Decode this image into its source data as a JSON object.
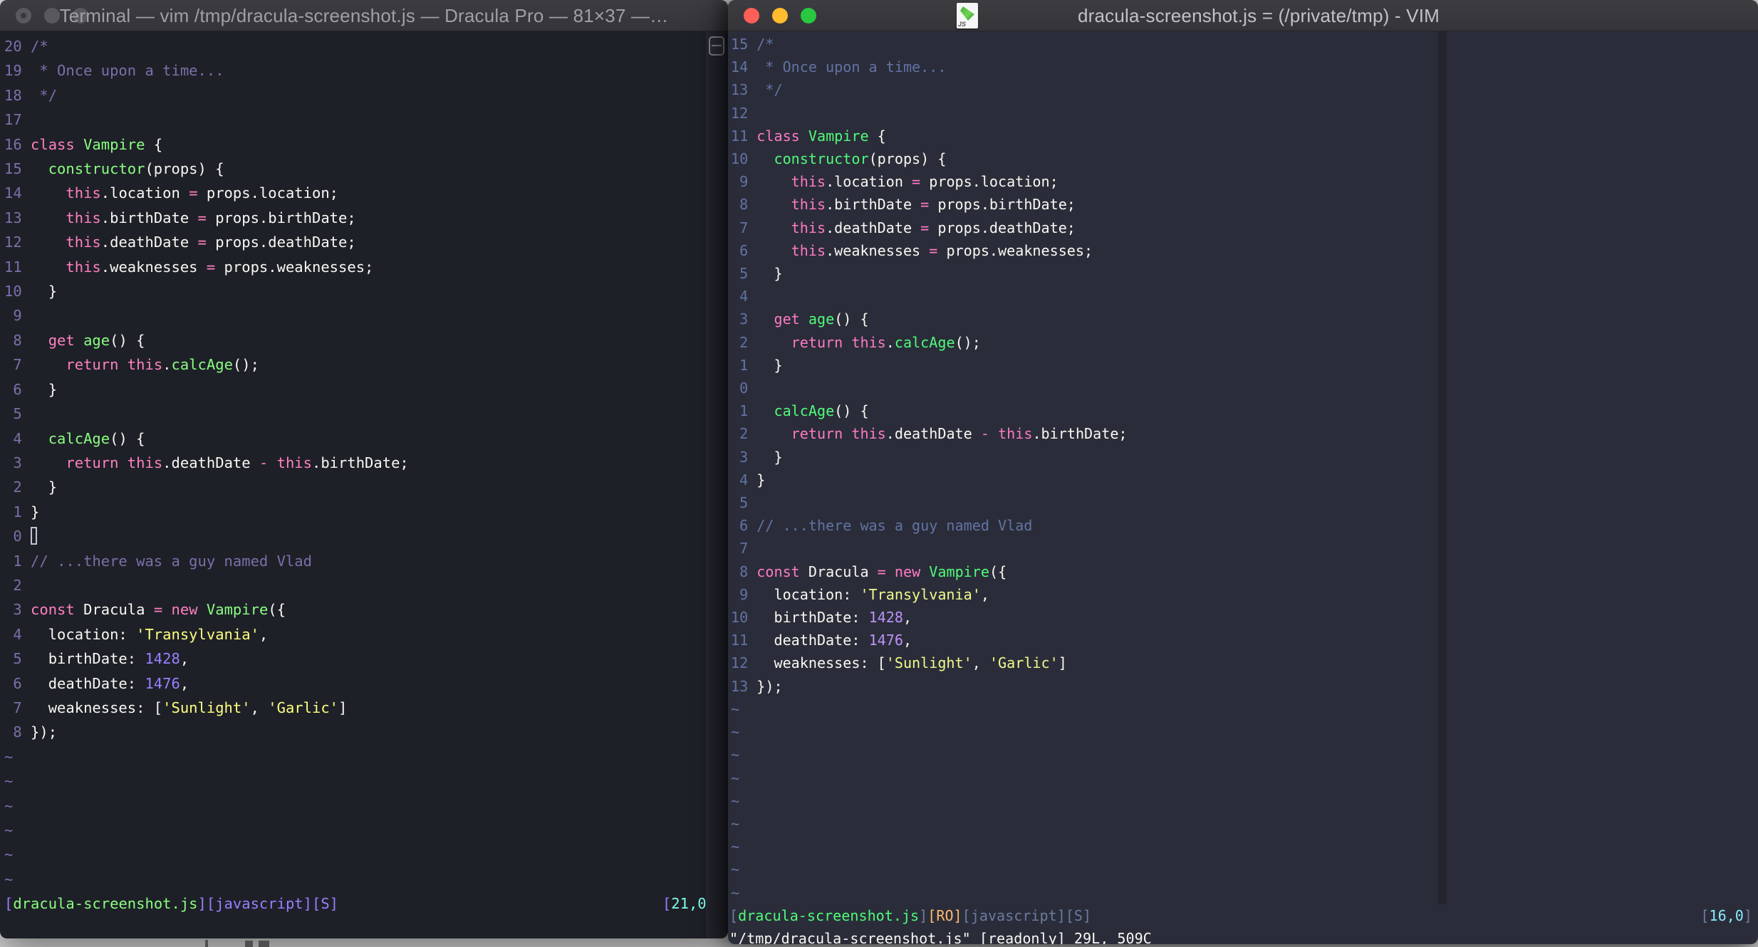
{
  "palette": {
    "desktop_bg": "#d8d8d8",
    "left_theme": {
      "name": "Dracula Pro (Terminal)",
      "background": "#1e2028",
      "foreground": "#f8f8f2",
      "comment": "#7970a9",
      "pink": "#ff80bf",
      "green": "#8aff80",
      "yellow": "#ffff80",
      "purple": "#9580ff",
      "cyan": "#80ffea",
      "line_number": "#7970a9"
    },
    "right_theme": {
      "name": "Dracula (MacVim)",
      "background": "#2a2d39",
      "foreground": "#f8f8f2",
      "comment": "#6272a4",
      "pink": "#ff79c6",
      "green": "#50fa7b",
      "yellow": "#f1fa8c",
      "purple": "#bd93f9",
      "cyan": "#8be9fd",
      "orange": "#ffb86c",
      "line_number": "#6272a4",
      "colorcolumn": "#23242e"
    },
    "traffic_lights_active": {
      "red": "#ff5f57",
      "yellow": "#febc2e",
      "green": "#28c840"
    },
    "traffic_lights_inactive": "#59585e"
  },
  "code_lines": [
    [
      [
        "c",
        "/*"
      ]
    ],
    [
      [
        "c",
        " * Once upon a time..."
      ]
    ],
    [
      [
        "c",
        " */"
      ]
    ],
    [],
    [
      [
        "k",
        "class"
      ],
      [
        "w",
        " "
      ],
      [
        "f",
        "Vampire"
      ],
      [
        "w",
        " {"
      ]
    ],
    [
      [
        "w",
        "  "
      ],
      [
        "f",
        "constructor"
      ],
      [
        "w",
        "(props) {"
      ]
    ],
    [
      [
        "w",
        "    "
      ],
      [
        "k",
        "this"
      ],
      [
        "w",
        ".location "
      ],
      [
        "k",
        "="
      ],
      [
        "w",
        " props.location;"
      ]
    ],
    [
      [
        "w",
        "    "
      ],
      [
        "k",
        "this"
      ],
      [
        "w",
        ".birthDate "
      ],
      [
        "k",
        "="
      ],
      [
        "w",
        " props.birthDate;"
      ]
    ],
    [
      [
        "w",
        "    "
      ],
      [
        "k",
        "this"
      ],
      [
        "w",
        ".deathDate "
      ],
      [
        "k",
        "="
      ],
      [
        "w",
        " props.deathDate;"
      ]
    ],
    [
      [
        "w",
        "    "
      ],
      [
        "k",
        "this"
      ],
      [
        "w",
        ".weaknesses "
      ],
      [
        "k",
        "="
      ],
      [
        "w",
        " props.weaknesses;"
      ]
    ],
    [
      [
        "w",
        "  }"
      ]
    ],
    [],
    [
      [
        "w",
        "  "
      ],
      [
        "k",
        "get"
      ],
      [
        "w",
        " "
      ],
      [
        "f",
        "age"
      ],
      [
        "w",
        "() {"
      ]
    ],
    [
      [
        "w",
        "    "
      ],
      [
        "k",
        "return"
      ],
      [
        "w",
        " "
      ],
      [
        "k",
        "this"
      ],
      [
        "w",
        "."
      ],
      [
        "f",
        "calcAge"
      ],
      [
        "w",
        "();"
      ]
    ],
    [
      [
        "w",
        "  }"
      ]
    ],
    [],
    [
      [
        "w",
        "  "
      ],
      [
        "f",
        "calcAge"
      ],
      [
        "w",
        "() {"
      ]
    ],
    [
      [
        "w",
        "    "
      ],
      [
        "k",
        "return"
      ],
      [
        "w",
        " "
      ],
      [
        "k",
        "this"
      ],
      [
        "w",
        ".deathDate "
      ],
      [
        "k",
        "-"
      ],
      [
        "w",
        " "
      ],
      [
        "k",
        "this"
      ],
      [
        "w",
        ".birthDate;"
      ]
    ],
    [
      [
        "w",
        "  }"
      ]
    ],
    [
      [
        "w",
        "}"
      ]
    ],
    [],
    [
      [
        "c",
        "// ...there was a guy named Vlad"
      ]
    ],
    [],
    [
      [
        "k",
        "const"
      ],
      [
        "w",
        " Dracula "
      ],
      [
        "k",
        "="
      ],
      [
        "w",
        " "
      ],
      [
        "k",
        "new"
      ],
      [
        "w",
        " "
      ],
      [
        "f",
        "Vampire"
      ],
      [
        "w",
        "({"
      ]
    ],
    [
      [
        "w",
        "  location: "
      ],
      [
        "s",
        "'Transylvania'"
      ],
      [
        "w",
        ","
      ]
    ],
    [
      [
        "w",
        "  birthDate: "
      ],
      [
        "n",
        "1428"
      ],
      [
        "w",
        ","
      ]
    ],
    [
      [
        "w",
        "  deathDate: "
      ],
      [
        "n",
        "1476"
      ],
      [
        "w",
        ","
      ]
    ],
    [
      [
        "w",
        "  weaknesses: ["
      ],
      [
        "s",
        "'Sunlight'"
      ],
      [
        "w",
        ", "
      ],
      [
        "s",
        "'Garlic'"
      ],
      [
        "w",
        "]"
      ]
    ],
    [
      [
        "w",
        "});"
      ]
    ]
  ],
  "tilde": "~",
  "left_window": {
    "title": "Terminal — vim /tmp/dracula-screenshot.js — Dracula Pro — 81×37 —…",
    "line_numbers": [
      "20",
      "19",
      "18",
      "17",
      "16",
      "15",
      "14",
      "13",
      "12",
      "11",
      "10",
      "9",
      "8",
      "7",
      "6",
      "5",
      "4",
      "3",
      "2",
      "1",
      "0",
      "1",
      "2",
      "3",
      "4",
      "5",
      "6",
      "7",
      "8"
    ],
    "cursor_row": 21,
    "cursor_visible": true,
    "tilde_rows": 6,
    "statusline": {
      "file_open": "[",
      "file": "dracula-screenshot.js",
      "file_close": "]",
      "filetype": "[javascript]",
      "flag": "[S]",
      "pos_open": "[",
      "position": "21,0",
      "pos_close": "]"
    }
  },
  "right_window": {
    "title": "dracula-screenshot.js = (/private/tmp) - VIM",
    "doc_icon_label": "JS",
    "line_numbers": [
      "15",
      "14",
      "13",
      "12",
      "11",
      "10",
      "9",
      "8",
      "7",
      "6",
      "5",
      "4",
      "3",
      "2",
      "1",
      "0",
      "1",
      "2",
      "3",
      "4",
      "5",
      "6",
      "7",
      "8",
      "9",
      "10",
      "11",
      "12",
      "13"
    ],
    "cursor_row": 16,
    "cursor_visible": false,
    "tilde_rows": 9,
    "statusline": {
      "file_open": "[",
      "file": "dracula-screenshot.js",
      "file_close": "]",
      "readonly": "[RO]",
      "filetype": "[javascript]",
      "flag": "[S]",
      "pos_open": "[",
      "position": "16,0",
      "pos_close": "]"
    },
    "command_line": "\"/tmp/dracula-screenshot.js\" [readonly] 29L, 509C"
  }
}
